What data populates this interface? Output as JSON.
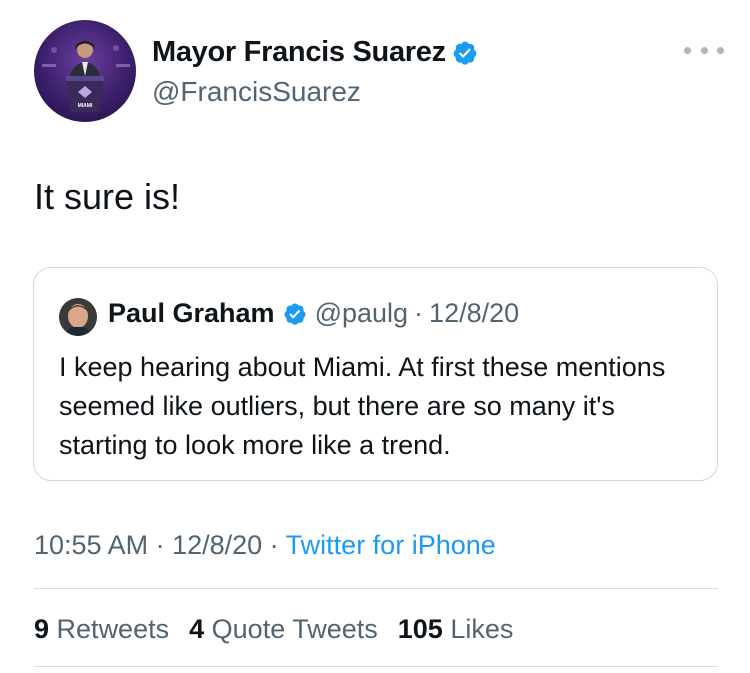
{
  "tweet": {
    "author_name": "Mayor Francis Suarez",
    "author_handle": "@FrancisSuarez",
    "text": "It sure is!",
    "avatar_sign_text": "MIAMI",
    "timestamp": "10:55 AM · 12/8/20",
    "separator": " · ",
    "source": "Twitter for iPhone"
  },
  "quoted_tweet": {
    "author_name": "Paul Graham",
    "author_handle": "@paulg",
    "separator": "·",
    "date": "12/8/20",
    "text": "I keep hearing about Miami. At first these mentions seemed like outliers, but there are so many it's starting to look more like a trend."
  },
  "stats": [
    {
      "count": "9",
      "label": "Retweets"
    },
    {
      "count": "4",
      "label": "Quote Tweets"
    },
    {
      "count": "105",
      "label": "Likes"
    }
  ],
  "colors": {
    "link": "#1d9bf0",
    "verified": "#1d9bf0",
    "secondary_text": "#536471",
    "divider": "#d9dee2"
  },
  "icons": {
    "verified": "verified-badge-icon",
    "more": "more-options-icon"
  }
}
